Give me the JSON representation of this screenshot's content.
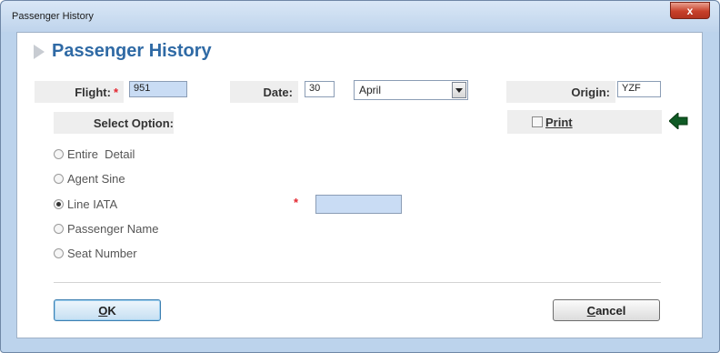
{
  "window": {
    "title": "Passenger History",
    "close_glyph": "x"
  },
  "header": {
    "title": "Passenger History"
  },
  "form": {
    "flight_label": "Flight:",
    "flight_value": "951",
    "date_label": "Date:",
    "date_day": "30",
    "date_month": "April",
    "origin_label": "Origin:",
    "origin_value": "YZF",
    "required_mark": "*",
    "select_option_label": "Select Option:",
    "print_label": "Print",
    "print_checked": false,
    "line_iata_value": ""
  },
  "options": [
    {
      "label": "Entire  Detail",
      "selected": false
    },
    {
      "label": "Agent Sine",
      "selected": false
    },
    {
      "label": "Line IATA",
      "selected": true
    },
    {
      "label": "Passenger Name",
      "selected": false
    },
    {
      "label": "Seat Number",
      "selected": false
    }
  ],
  "buttons": {
    "ok": "OK",
    "cancel": "Cancel"
  },
  "colors": {
    "accent": "#2f6aa5",
    "required": "#e3262f",
    "arrow": "#0f5a25"
  }
}
